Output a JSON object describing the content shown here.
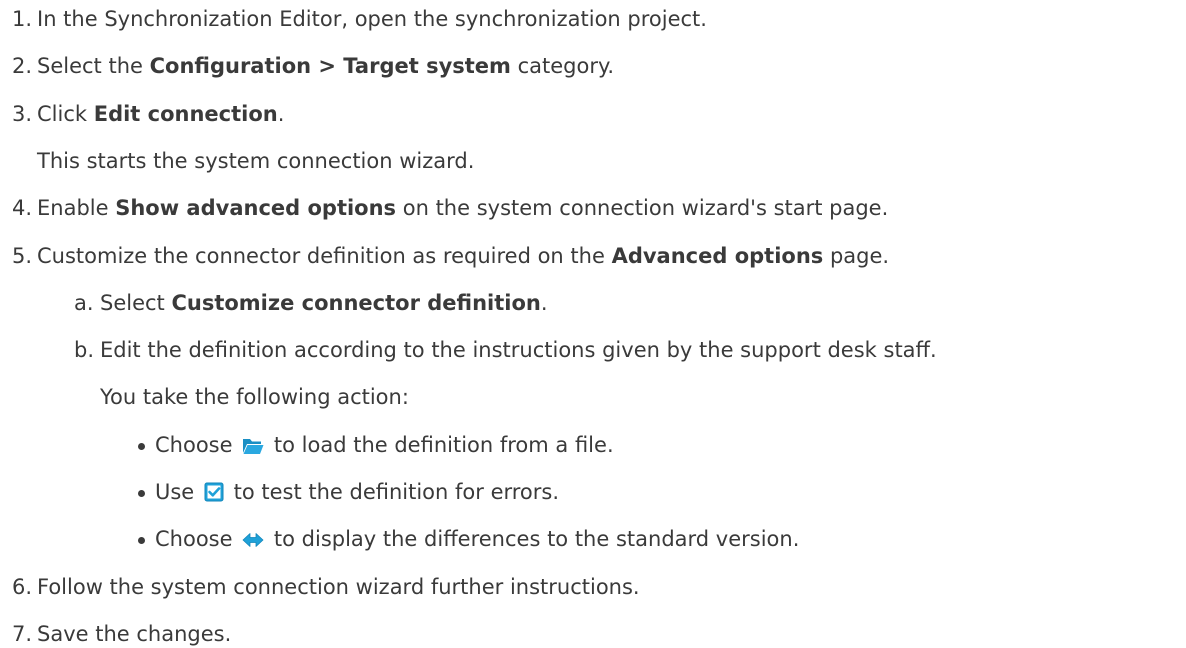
{
  "steps": [
    {
      "num": "1.",
      "text": "In the Synchronization Editor, open the synchronization project."
    },
    {
      "num": "2.",
      "pre": "Select the ",
      "bold": "Configuration > Target system",
      "post": " category."
    },
    {
      "num": "3.",
      "pre": "Click ",
      "bold": "Edit connection",
      "post": "."
    },
    {
      "note": "This starts the system connection wizard."
    },
    {
      "num": "4.",
      "pre": "Enable ",
      "bold": "Show advanced options",
      "post": " on the system connection wizard's start page."
    },
    {
      "num": "5.",
      "pre": "Customize the connector definition as required on the ",
      "bold": "Advanced options",
      "post": " page."
    },
    {
      "num": "6.",
      "text": "Follow the system connection wizard further instructions."
    },
    {
      "num": "7.",
      "text": "Save the changes."
    }
  ],
  "substeps": [
    {
      "letter": "a.",
      "pre": "Select ",
      "bold": "Customize connector definition",
      "post": "."
    },
    {
      "letter": "b.",
      "line1": "Edit the definition according to the instructions given by the support desk staff.",
      "line2": "You take the following action:"
    }
  ],
  "bullets": [
    {
      "pre": "Choose ",
      "icon": "folder-open-icon",
      "post": " to load the definition from a file."
    },
    {
      "pre": "Use ",
      "icon": "checkbox-checked-icon",
      "post": " to test the definition for errors."
    },
    {
      "pre": "Choose ",
      "icon": "compare-arrows-icon",
      "post": " to display the differences to the standard version."
    }
  ],
  "colors": {
    "text": "#3a3a3a",
    "icon_blue": "#1fa1d8"
  }
}
